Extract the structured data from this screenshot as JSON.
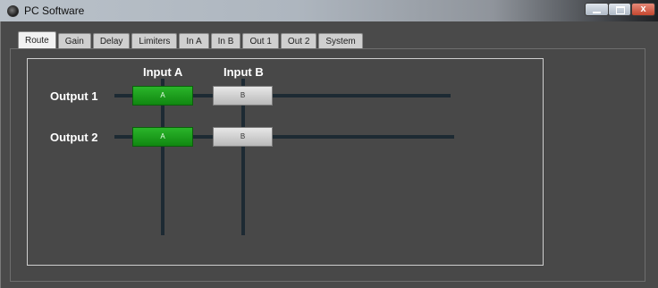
{
  "window": {
    "title": "PC Software",
    "close_label": "x"
  },
  "tabs": [
    {
      "label": "Route",
      "active": true
    },
    {
      "label": "Gain",
      "active": false
    },
    {
      "label": "Delay",
      "active": false
    },
    {
      "label": "Limiters",
      "active": false
    },
    {
      "label": "In A",
      "active": false
    },
    {
      "label": "In B",
      "active": false
    },
    {
      "label": "Out 1",
      "active": false
    },
    {
      "label": "Out 2",
      "active": false
    },
    {
      "label": "System",
      "active": false
    }
  ],
  "route": {
    "inputs": [
      "Input A",
      "Input B"
    ],
    "outputs": [
      "Output 1",
      "Output 2"
    ],
    "matrix": [
      [
        {
          "label": "A",
          "on": true
        },
        {
          "label": "B",
          "on": false
        }
      ],
      [
        {
          "label": "A",
          "on": true
        },
        {
          "label": "B",
          "on": false
        }
      ]
    ]
  },
  "colors": {
    "active": "#1f9e1f",
    "inactive": "#cfcfcf",
    "line": "#1d2a33",
    "background": "#4a4a4a"
  }
}
